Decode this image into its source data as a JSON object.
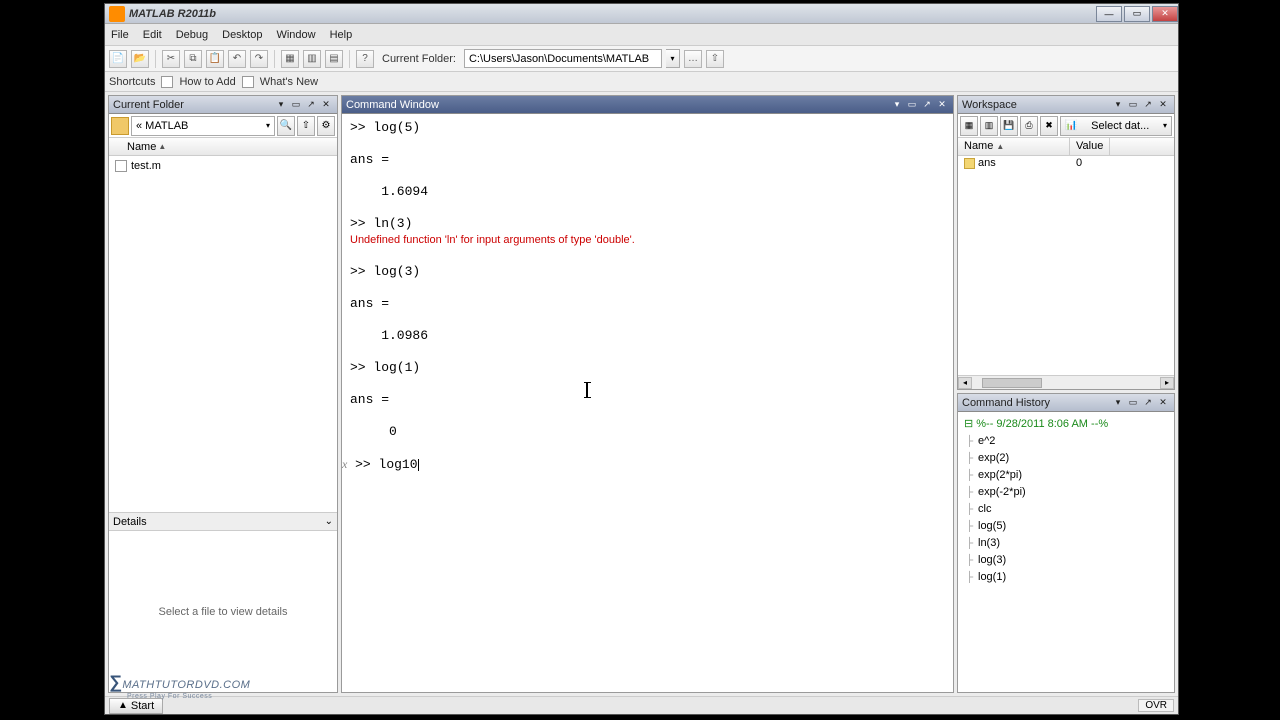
{
  "window": {
    "title": "MATLAB R2011b"
  },
  "menubar": [
    "File",
    "Edit",
    "Debug",
    "Desktop",
    "Window",
    "Help"
  ],
  "toolbar_current_folder": {
    "label": "Current Folder:",
    "path": "C:\\Users\\Jason\\Documents\\MATLAB"
  },
  "shortcuts": {
    "label": "Shortcuts",
    "items": [
      "How to Add",
      "What's New"
    ]
  },
  "current_folder": {
    "title": "Current Folder",
    "breadcrumb": "« MATLAB",
    "name_header": "Name",
    "files": [
      {
        "name": "test.m"
      }
    ],
    "details_title": "Details",
    "details_placeholder": "Select a file to view details"
  },
  "command_window": {
    "title": "Command Window",
    "lines": [
      ">> log(5)",
      "",
      "ans =",
      "",
      "    1.6094",
      "",
      ">> ln(3)",
      "Undefined function 'ln' for input arguments of type 'double'.",
      "",
      ">> log(3)",
      "",
      "ans =",
      "",
      "    1.0986",
      "",
      ">> log(1)",
      "",
      "ans =",
      "",
      "     0",
      ""
    ],
    "input_prefix": ">> ",
    "input_value": "log10",
    "fx_label": "fx"
  },
  "workspace": {
    "title": "Workspace",
    "select_data": "Select dat...",
    "columns": [
      "Name",
      "Value"
    ],
    "rows": [
      {
        "name": "ans",
        "value": "0"
      }
    ]
  },
  "command_history": {
    "title": "Command History",
    "timestamp": "%-- 9/28/2011 8:06 AM --%",
    "items": [
      "e^2",
      "exp(2)",
      "exp(2*pi)",
      "exp(-2*pi)",
      "clc",
      "log(5)",
      "ln(3)",
      "log(3)",
      "log(1)"
    ]
  },
  "statusbar": {
    "start": "Start",
    "ovr": "OVR"
  },
  "watermark": {
    "main": "MATHTUTORDVD.COM",
    "sub": "Press Play For Success"
  }
}
